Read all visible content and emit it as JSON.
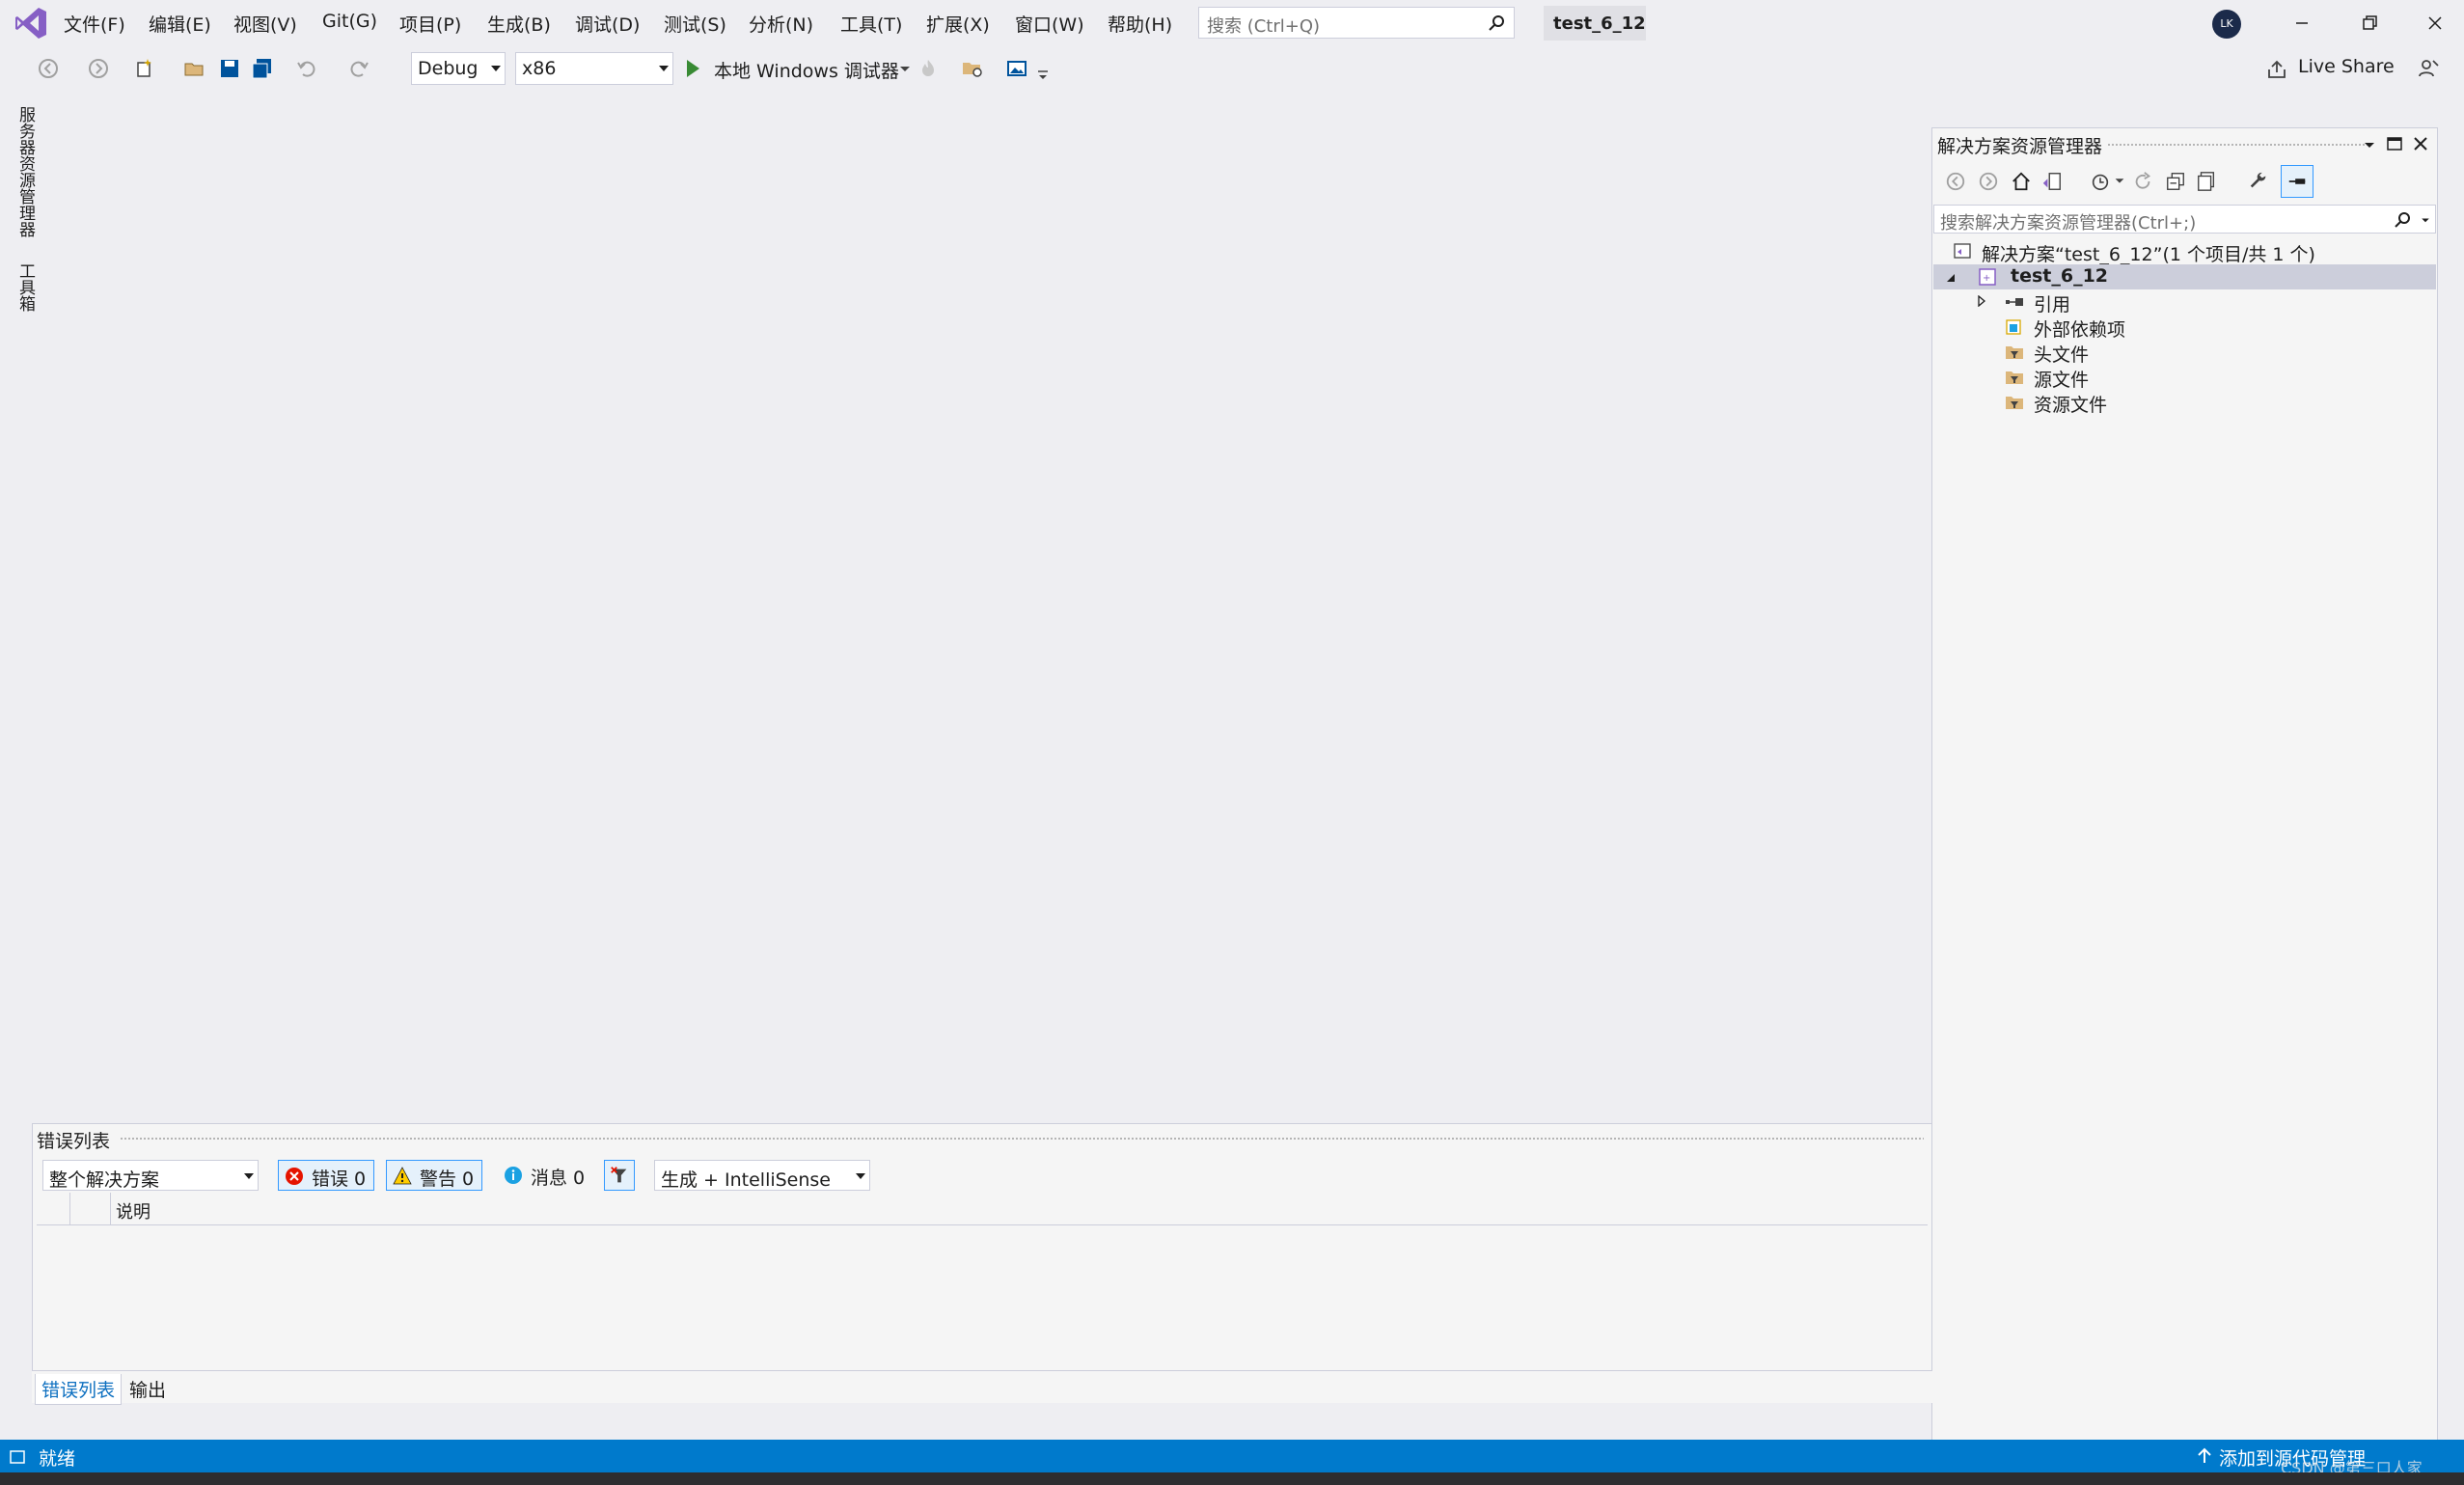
{
  "menu": {
    "items": [
      "文件(F)",
      "编辑(E)",
      "视图(V)",
      "Git(G)",
      "项目(P)",
      "生成(B)",
      "调试(D)",
      "测试(S)",
      "分析(N)",
      "工具(T)",
      "扩展(X)",
      "窗口(W)",
      "帮助(H)"
    ]
  },
  "search": {
    "placeholder": "搜索 (Ctrl+Q)"
  },
  "solution_tag": "test_6_12",
  "user": {
    "initials": "LK"
  },
  "toolbar": {
    "config": "Debug",
    "platform": "x86",
    "run_label": "本地 Windows 调试器",
    "live_share": "Live Share"
  },
  "left_tabs": [
    "服务器资源管理器",
    "工具箱"
  ],
  "solution_explorer": {
    "title": "解决方案资源管理器",
    "search_placeholder": "搜索解决方案资源管理器(Ctrl+;)",
    "solution_node": "解决方案“test_6_12”(1 个项目/共 1 个)",
    "project_node": "test_6_12",
    "children": [
      "引用",
      "外部依赖项",
      "头文件",
      "源文件",
      "资源文件"
    ]
  },
  "error_list": {
    "title": "错误列表",
    "scope": "整个解决方案",
    "errors_label": "错误 0",
    "warnings_label": "警告 0",
    "messages_label": "消息 0",
    "source": "生成 + IntelliSense",
    "column_description": "说明",
    "tabs": [
      "错误列表",
      "输出"
    ]
  },
  "status": {
    "text": "就绪",
    "right_text": "添加到源代码管理",
    "watermark": "CSDN @第三口人家"
  },
  "colors": {
    "accent": "#007ACC",
    "vs_purple": "#865FC5",
    "run_green": "#388A34",
    "error_red": "#E51400",
    "warning_yellow": "#FFCC00",
    "info_blue": "#1BA1E2"
  }
}
